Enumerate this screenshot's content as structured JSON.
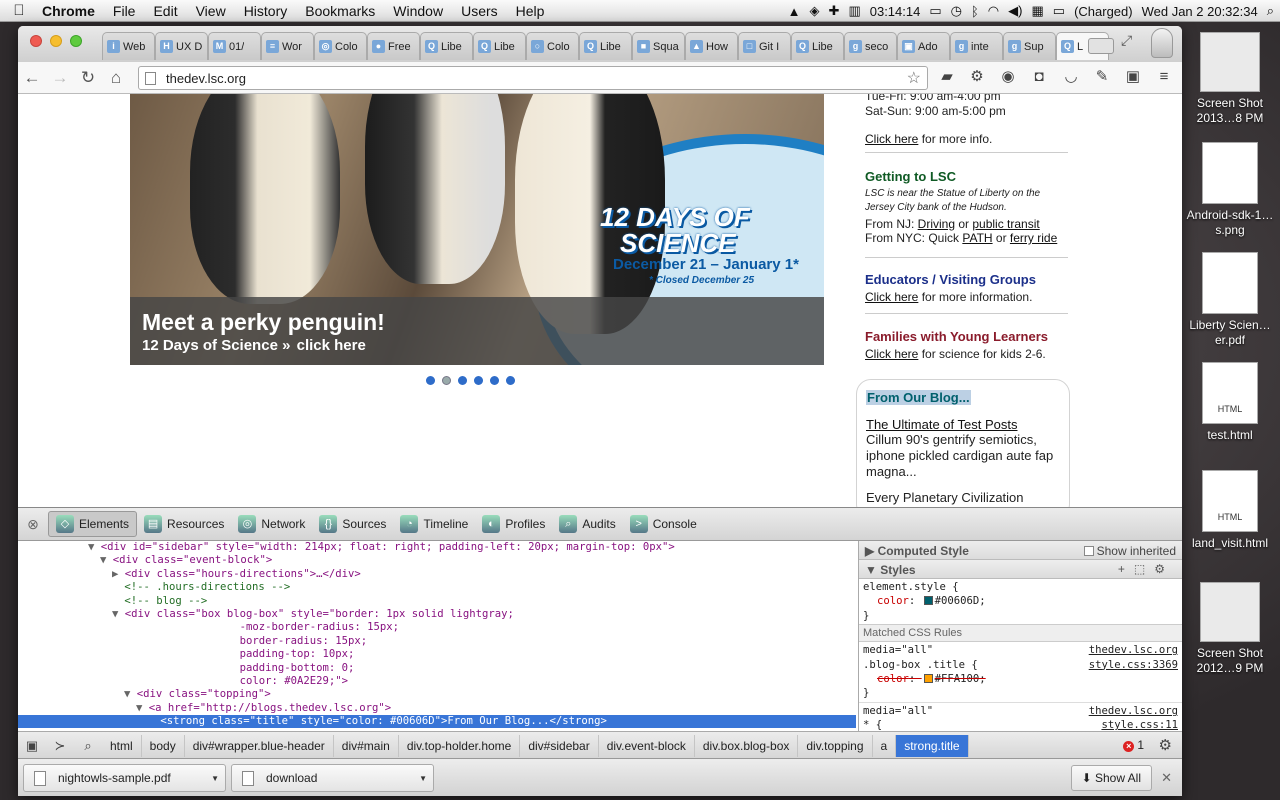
{
  "menubar": {
    "apple": "",
    "app": "Chrome",
    "items": [
      "File",
      "Edit",
      "View",
      "History",
      "Bookmarks",
      "Window",
      "Users",
      "Help"
    ],
    "timer": "03:14:14",
    "battery": "(Charged)",
    "clock": "Wed Jan 2  20:32:34"
  },
  "desktop": {
    "icons": [
      {
        "label": "Screen Shot 2013…8 PM"
      },
      {
        "label": "Android-sdk-1…s.png"
      },
      {
        "label": "Liberty Scien…er.pdf"
      },
      {
        "label": "test.html",
        "tag": "HTML"
      },
      {
        "label": "land_visit.html",
        "tag": "HTML"
      },
      {
        "label": "Screen Shot 2012…9 PM"
      }
    ]
  },
  "tabs": [
    {
      "fav": "i",
      "title": "Web"
    },
    {
      "fav": "H",
      "title": "UX D"
    },
    {
      "fav": "M",
      "title": "01/"
    },
    {
      "fav": "≡",
      "title": "Wor"
    },
    {
      "fav": "◎",
      "title": "Colo"
    },
    {
      "fav": "●",
      "title": "Free"
    },
    {
      "fav": "Q",
      "title": "Libe"
    },
    {
      "fav": "Q",
      "title": "Libe"
    },
    {
      "fav": "○",
      "title": "Colo"
    },
    {
      "fav": "Q",
      "title": "Libe"
    },
    {
      "fav": "■",
      "title": "Squa"
    },
    {
      "fav": "▲",
      "title": "How"
    },
    {
      "fav": "□",
      "title": "Git I"
    },
    {
      "fav": "Q",
      "title": "Libe"
    },
    {
      "fav": "g",
      "title": "seco"
    },
    {
      "fav": "▣",
      "title": "Ado"
    },
    {
      "fav": "g",
      "title": "inte"
    },
    {
      "fav": "g",
      "title": "Sup"
    },
    {
      "fav": "Q",
      "title": "L"
    }
  ],
  "address": {
    "url": "thedev.lsc.org"
  },
  "hero": {
    "days_line1": "12 DAYS OF",
    "days_line2": "SCIENCE",
    "dates": "December 21 – January 1*",
    "closed": "* Closed December 25",
    "caption_title": "Meet a perky penguin!",
    "caption_sub": "12 Days of Science",
    "caption_arrow": "»",
    "caption_link": "click here"
  },
  "sidebar": {
    "hours1": "Tue-Fri: 9:00 am-4:00 pm",
    "hours2": "Sat-Sun: 9:00 am-5:00 pm",
    "more_link": "Click here",
    "more_text": " for more info.",
    "getting": {
      "title": "Getting to LSC",
      "note": "LSC is near the Statue of Liberty on the Jersey City bank of the Hudson.",
      "nj_prefix": "From NJ: ",
      "nj_link1": "Driving",
      "nj_or": " or ",
      "nj_link2": "public transit",
      "ny_prefix": "From NYC: Quick ",
      "ny_link1": "PATH",
      "ny_or": " or ",
      "ny_link2": "ferry ride"
    },
    "educators": {
      "title": "Educators / Visiting Groups",
      "link": "Click here",
      "text": " for more information."
    },
    "families": {
      "title": "Families with Young Learners",
      "link": "Click here",
      "text": " for science for kids 2-6."
    },
    "blog": {
      "title": "From Our Blog...",
      "post_title": "The Ultimate of Test Posts",
      "excerpt": "Cillum 90's gentrify semiotics, iphone pickled cardigan aute fap magna...",
      "post2": "Every Planetary Civilization"
    }
  },
  "devtools": {
    "tabs": [
      "Elements",
      "Resources",
      "Network",
      "Sources",
      "Timeline",
      "Profiles",
      "Audits",
      "Console"
    ],
    "dom_lines": [
      {
        "i": "▼",
        "t": "<div id=\"sidebar\" style=\"width: 214px; float: right; padding-left: 20px; margin-top: 0px\">"
      },
      {
        "i": "▼",
        "t": "<div class=\"event-block\">"
      },
      {
        "i": "▶",
        "t": "<div class=\"hours-directions\">…</div>"
      },
      {
        "i": "",
        "t": "<!-- .hours-directions -->"
      },
      {
        "i": "",
        "t": "<!-- blog -->"
      },
      {
        "i": "▼",
        "t": "<div class=\"box blog-box\" style=\"border: 1px solid lightgray;"
      },
      {
        "i": "",
        "t": "                   -moz-border-radius: 15px;"
      },
      {
        "i": "",
        "t": "                   border-radius: 15px;"
      },
      {
        "i": "",
        "t": "                   padding-top: 10px;"
      },
      {
        "i": "",
        "t": "                   padding-bottom: 0;"
      },
      {
        "i": "",
        "t": "                   color: #0A2E29;\">"
      },
      {
        "i": "▼",
        "t": "<div class=\"topping\">"
      },
      {
        "i": "▼",
        "t": "<a href=\"http://blogs.thedev.lsc.org\">"
      },
      {
        "i": "",
        "t": "<strong class=\"title\" style=\"color: #00606D\">From Our Blog...</strong>"
      }
    ],
    "computed_label": "Computed Style",
    "show_inherited": "Show inherited",
    "styles_label": "Styles",
    "element_style": "element.style {",
    "element_prop": "color",
    "element_val": "#00606D;",
    "matched_label": "Matched CSS Rules",
    "rule1_media": "media=\"all\"",
    "rule1_src": "thedev.lsc.org",
    "rule1_sel": ".blog-box .title {",
    "rule1_file": "style.css:3369",
    "rule1_prop": "color",
    "rule1_val": "#FFA100;",
    "rule2_media": "media=\"all\"",
    "rule2_src": "thedev.lsc.org",
    "rule2_sel": "* {",
    "rule2_file": "style.css:11",
    "close_brace": "}",
    "crumbs": [
      "html",
      "body",
      "div#wrapper.blue-header",
      "div#main",
      "div.top-holder.home",
      "div#sidebar",
      "div.event-block",
      "div.box.blog-box",
      "div.topping",
      "a",
      "strong.title"
    ],
    "errors": "1"
  },
  "downloads": [
    {
      "name": "nightowls-sample.pdf"
    },
    {
      "name": "download"
    }
  ],
  "shelf": {
    "show_all": "Show All"
  },
  "colors": {
    "swatch_teal": "#00606D",
    "swatch_orange": "#FFA100",
    "selection": "#3875d7"
  }
}
